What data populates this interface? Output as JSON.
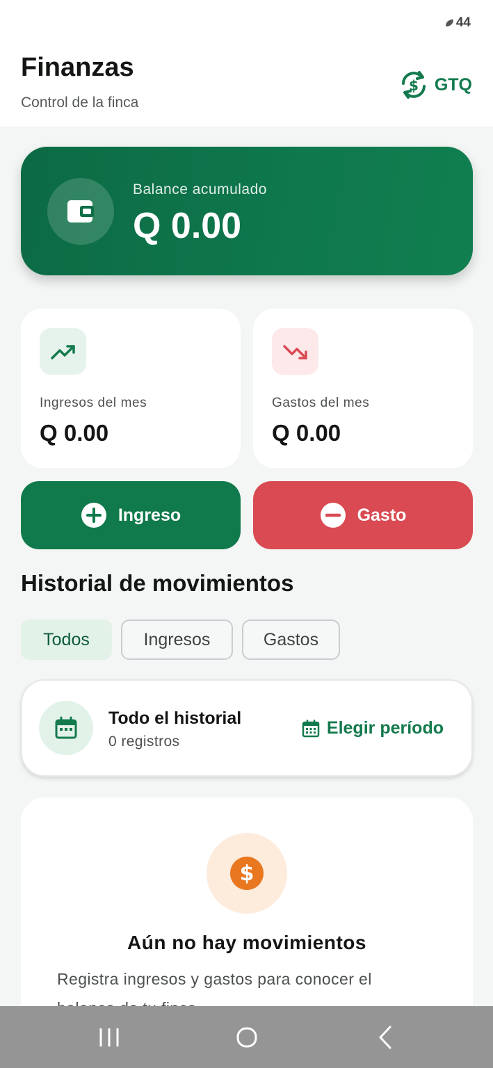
{
  "status_bar": {
    "signal_text": "44"
  },
  "header": {
    "title": "Finanzas",
    "subtitle": "Control de la finca",
    "currency_label": "GTQ"
  },
  "balance": {
    "label": "Balance acumulado",
    "value": "Q 0.00"
  },
  "stats": {
    "income": {
      "label": "Ingresos del mes",
      "value": "Q 0.00"
    },
    "expense": {
      "label": "Gastos del mes",
      "value": "Q 0.00"
    }
  },
  "actions": {
    "income_label": "Ingreso",
    "expense_label": "Gasto"
  },
  "history": {
    "title": "Historial de movimientos",
    "filters": [
      "Todos",
      "Ingresos",
      "Gastos"
    ],
    "selected_filter": "Todos",
    "period": {
      "title": "Todo el historial",
      "count": "0 registros",
      "action_label": "Elegir período"
    },
    "empty": {
      "title": "Aún no hay movimientos",
      "description": "Registra ingresos y gastos para conocer el balance de tu finca."
    }
  },
  "colors": {
    "brand_green": "#107a4c",
    "expense_red": "#d94a52",
    "empty_orange": "#e8771f"
  },
  "icons": {
    "currency": "currency-exchange-icon",
    "balance": "wallet-icon",
    "income": "trending-up-icon",
    "expense": "trending-down-icon",
    "add": "plus-circle-icon",
    "remove": "minus-circle-icon",
    "calendar": "calendar-icon",
    "empty": "dollar-coin-icon"
  }
}
